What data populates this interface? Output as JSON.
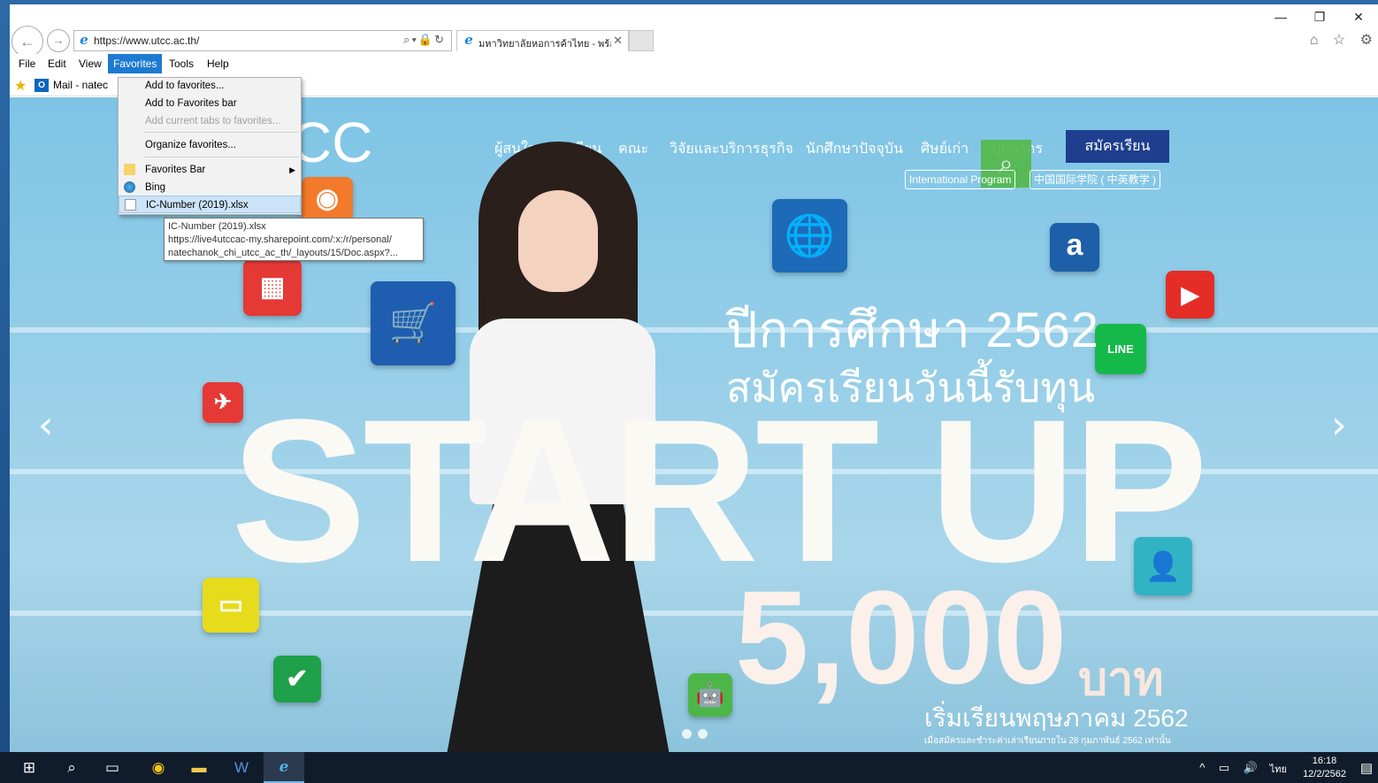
{
  "browser": {
    "address_url": "https://www.utcc.ac.th/",
    "tab_title": "มหาวิทยาลัยหอการค้าไทย - พร้อ...",
    "tab_close": "✕",
    "window_controls": {
      "minimize": "—",
      "restore": "❐",
      "close": "✕"
    },
    "right_icons": "⌂ ☆ ⚙"
  },
  "menubar": {
    "file": "File",
    "edit": "Edit",
    "view": "View",
    "favorites": "Favorites",
    "tools": "Tools",
    "help": "Help"
  },
  "favorites_bar": {
    "mail_label": "Mail - natec"
  },
  "favorites_menu": {
    "add_to_favorites": "Add to favorites...",
    "add_to_favorites_bar": "Add to Favorites bar",
    "add_current_tabs": "Add current tabs to favorites...",
    "organize": "Organize favorites...",
    "favorites_bar": "Favorites Bar",
    "bing": "Bing",
    "ic_number": "IC-Number (2019).xlsx"
  },
  "tooltip": {
    "line1": "IC-Number (2019).xlsx",
    "line2": "https://live4utccac-my.sharepoint.com/:x:/r/personal/",
    "line3": "natechanok_chi_utcc_ac_th/_layouts/15/Doc.aspx?..."
  },
  "website": {
    "logo_fragment": "CC",
    "nav": {
      "interested": "ผู้สนใจสมัครเรียน",
      "faculties": "คณะ",
      "research": "วิจัยและบริการธุรกิจ",
      "current_students": "นักศึกษาปัจจุบัน",
      "alumni": "ศิษย์เก่า",
      "staff": "บุคลากร"
    },
    "apply_button": "สมัครเรียน",
    "international_program": "International Program",
    "chinese_college": "中国国际学院 ( 中英教学 )",
    "headline_year": "ปีการศึกษา 2562",
    "headline_sub": "สมัครเรียนวันนี้รับทุน",
    "startup": "START UP",
    "amount": "5,000",
    "baht": "บาท",
    "start_date": "เริ่มเรียนพฤษภาคม 2562",
    "fine_print": "เมื่อสมัครและชำระค่าเล่าเรียนภายใน 28 กุมภาพันธ์ 2562 เท่านั้น",
    "prev_arrow": "‹",
    "next_arrow": "›"
  },
  "taskbar": {
    "lang": "ไทย",
    "time": "16:18",
    "date": "12/2/2562"
  },
  "colors": {
    "accent": "#1c7ad2",
    "apply_button": "#1e3f8e",
    "line_green": "#15b94a",
    "youtube_red": "#e52d27"
  }
}
